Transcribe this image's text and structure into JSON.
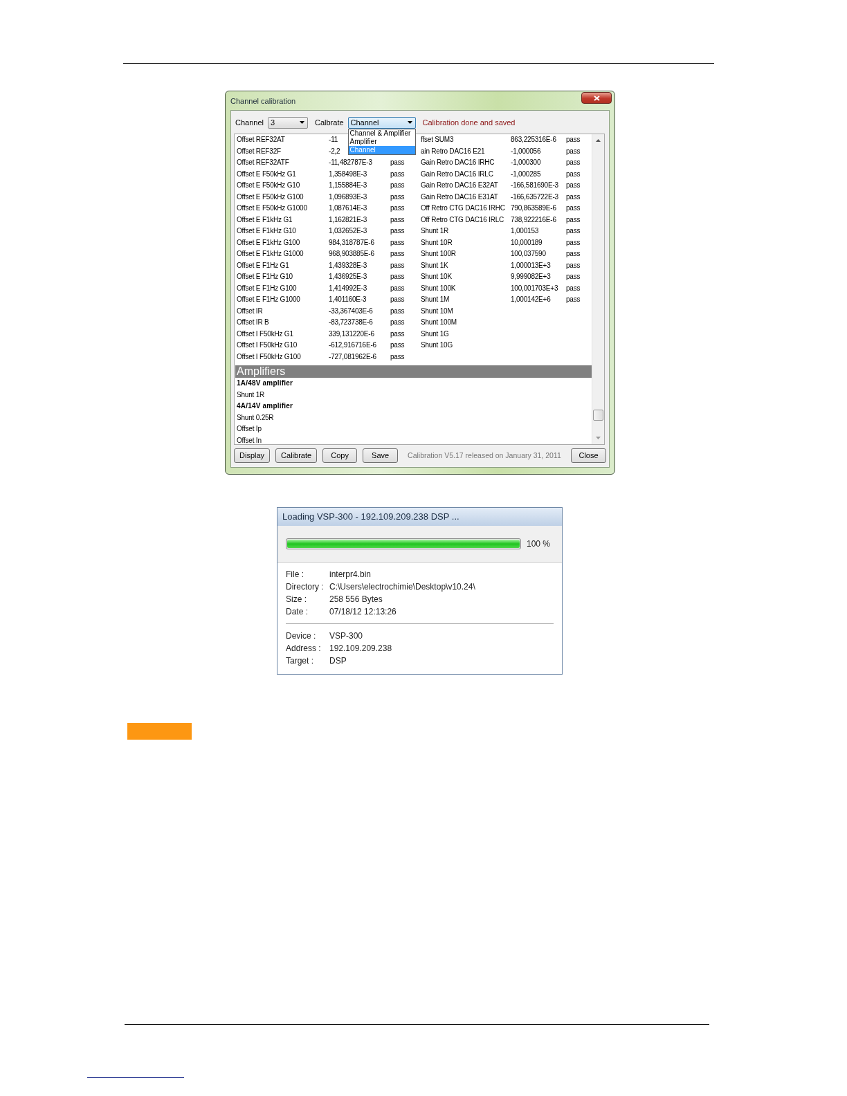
{
  "calibration_dialog": {
    "title": "Channel calibration",
    "channel_label": "Channel",
    "channel_value": "3",
    "calibrate_label": "Calbrate",
    "calibrate_value": "Channel",
    "calibrate_options": [
      {
        "label": "Channel & Amplifier",
        "selected": false
      },
      {
        "label": "Amplifier",
        "selected": false
      },
      {
        "label": "Channel",
        "selected": true
      }
    ],
    "message": "Calibration done and saved",
    "results": [
      {
        "column_1": "Offset REF32AT",
        "column_2": "-11",
        "column_4": "ffset SUM3",
        "column_5": "863,225316E-6",
        "column_6": "pass"
      },
      {
        "column_1": "Offset REF32F",
        "column_2": "-2,2",
        "column_4": "ain Retro DAC16 E21",
        "column_5": "-1,000056",
        "column_6": "pass"
      },
      {
        "column_1": "Offset REF32ATF",
        "column_2": "-11,482787E-3",
        "column_3": "pass",
        "column_4": "Gain Retro DAC16 IRHC",
        "column_5": "-1,000300",
        "column_6": "pass"
      },
      {
        "column_1": "Offset E F50kHz G1",
        "column_2": "1,358498E-3",
        "column_3": "pass",
        "column_4": "Gain Retro DAC16 IRLC",
        "column_5": "-1,000285",
        "column_6": "pass"
      },
      {
        "column_1": "Offset E F50kHz G10",
        "column_2": "1,155884E-3",
        "column_3": "pass",
        "column_4": "Gain Retro DAC16 E32AT",
        "column_5": "-166,581690E-3",
        "column_6": "pass"
      },
      {
        "column_1": "Offset E F50kHz G100",
        "column_2": "1,096893E-3",
        "column_3": "pass",
        "column_4": "Gain Retro DAC16 E31AT",
        "column_5": "-166,635722E-3",
        "column_6": "pass"
      },
      {
        "column_1": "Offset E F50kHz G1000",
        "column_2": "1,087614E-3",
        "column_3": "pass",
        "column_4": "Off Retro CTG DAC16 IRHC",
        "column_5": "790,863589E-6",
        "column_6": "pass"
      },
      {
        "column_1": "Offset E F1kHz G1",
        "column_2": "1,162821E-3",
        "column_3": "pass",
        "column_4": "Off Retro CTG DAC16 IRLC",
        "column_5": "738,922216E-6",
        "column_6": "pass"
      },
      {
        "column_1": "Offset E F1kHz G10",
        "column_2": "1,032652E-3",
        "column_3": "pass",
        "column_4": "Shunt 1R",
        "column_5": "1,000153",
        "column_6": "pass"
      },
      {
        "column_1": "Offset E F1kHz G100",
        "column_2": "984,318787E-6",
        "column_3": "pass",
        "column_4": "Shunt 10R",
        "column_5": "10,000189",
        "column_6": "pass"
      },
      {
        "column_1": "Offset E F1kHz G1000",
        "column_2": "968,903885E-6",
        "column_3": "pass",
        "column_4": "Shunt 100R",
        "column_5": "100,037590",
        "column_6": "pass"
      },
      {
        "column_1": "Offset E F1Hz G1",
        "column_2": "1,439328E-3",
        "column_3": "pass",
        "column_4": "Shunt 1K",
        "column_5": "1,000013E+3",
        "column_6": "pass"
      },
      {
        "column_1": "Offset E F1Hz G10",
        "column_2": "1,436925E-3",
        "column_3": "pass",
        "column_4": "Shunt 10K",
        "column_5": "9,999082E+3",
        "column_6": "pass"
      },
      {
        "column_1": "Offset E F1Hz G100",
        "column_2": "1,414992E-3",
        "column_3": "pass",
        "column_4": "Shunt 100K",
        "column_5": "100,001703E+3",
        "column_6": "pass"
      },
      {
        "column_1": "Offset E F1Hz G1000",
        "column_2": "1,401160E-3",
        "column_3": "pass",
        "column_4": "Shunt 1M",
        "column_5": "1,000142E+6",
        "column_6": "pass"
      },
      {
        "column_1": "Offset IR",
        "column_2": "-33,367403E-6",
        "column_3": "pass",
        "column_4": "Shunt 10M"
      },
      {
        "column_1": "Offset IR B",
        "column_2": "-83,723738E-6",
        "column_3": "pass",
        "column_4": "Shunt 100M"
      },
      {
        "column_1": "Offset I F50kHz G1",
        "column_2": "339,131220E-6",
        "column_3": "pass",
        "column_4": "Shunt 1G"
      },
      {
        "column_1": "Offset I F50kHz G10",
        "column_2": "-612,916716E-6",
        "column_3": "pass",
        "column_4": "Shunt 10G"
      },
      {
        "column_1": "Offset I F50kHz G100",
        "column_2": "-727,081962E-6",
        "column_3": "pass"
      }
    ],
    "section_title": "Amplifiers",
    "amplifier_items": [
      {
        "kind": "heading",
        "text": "1A/48V amplifier"
      },
      {
        "kind": "item",
        "text": "Shunt 1R"
      },
      {
        "kind": "heading",
        "text": "4A/14V amplifier"
      },
      {
        "kind": "item",
        "text": "Shunt 0.25R"
      },
      {
        "kind": "item",
        "text": "Offset Ip"
      },
      {
        "kind": "item",
        "text": "Offset In"
      }
    ],
    "buttons": [
      "Display",
      "Calibrate",
      "Copy",
      "Save"
    ],
    "version": "Calibration V5.17 released on January 31, 2011",
    "close_button": "Close"
  },
  "loading_dialog": {
    "title": "Loading VSP-300 - 192.109.209.238 DSP ...",
    "progress": {
      "level": 1,
      "reading": "100 %"
    },
    "file_info": [
      {
        "label": "File :",
        "value": "interpr4.bin"
      },
      {
        "label": "Directory :",
        "value": "C:\\Users\\electrochimie\\Desktop\\v10.24\\"
      },
      {
        "label": "Size :",
        "value": "258 556 Bytes"
      },
      {
        "label": "Date :",
        "value": "07/18/12 12:13:26"
      }
    ],
    "device_info": [
      {
        "label": "Device :",
        "value": "VSP-300"
      },
      {
        "label": "Address :",
        "value": "192.109.209.238"
      },
      {
        "label": "Target :",
        "value": "DSP"
      }
    ]
  }
}
